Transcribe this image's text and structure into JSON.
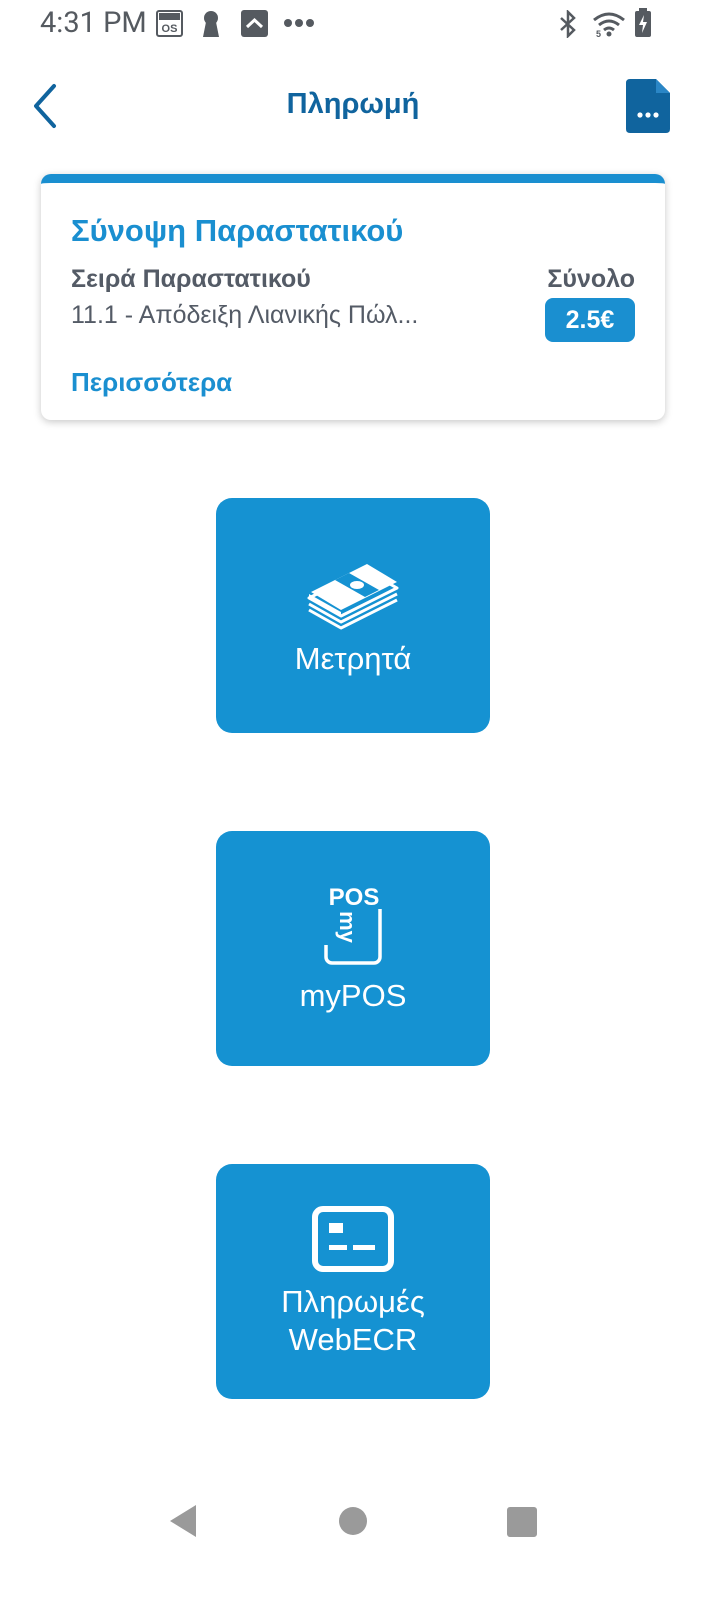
{
  "status_bar": {
    "time": "4:31 PM",
    "left_icons": [
      "sunmi-os-icon",
      "keyhole-icon",
      "chevron-up-box-icon",
      "more-dots-icon"
    ],
    "right_icons": [
      "bluetooth-icon",
      "wifi-5g-icon",
      "battery-charging-icon"
    ]
  },
  "header": {
    "title": "Πληρωμή",
    "back_icon": "chevron-left-icon",
    "document_icon": "document-more-icon"
  },
  "summary": {
    "title": "Σύνοψη Παραστατικού",
    "series_label": "Σειρά Παραστατικού",
    "series_value": "11.1 - Απόδειξη Λιανικής Πώλ...",
    "total_label": "Σύνολο",
    "total_value": "2.5€",
    "more_link": "Περισσότερα"
  },
  "payment_methods": [
    {
      "label": "Μετρητά",
      "icon": "cash-stack-icon"
    },
    {
      "label": "myPOS",
      "icon": "mypos-device-icon",
      "icon_text_top": "POS",
      "icon_text_side": "my"
    },
    {
      "label_line1": "Πληρωμές",
      "label_line2": "WebECR",
      "icon": "card-terminal-icon"
    }
  ],
  "colors": {
    "accent": "#1a8fd0",
    "tile": "#1592d2",
    "header_title": "#10649e",
    "text_gray": "#545b66"
  },
  "nav_bar": {
    "icons": [
      "nav-back-icon",
      "nav-home-icon",
      "nav-recents-icon"
    ]
  }
}
